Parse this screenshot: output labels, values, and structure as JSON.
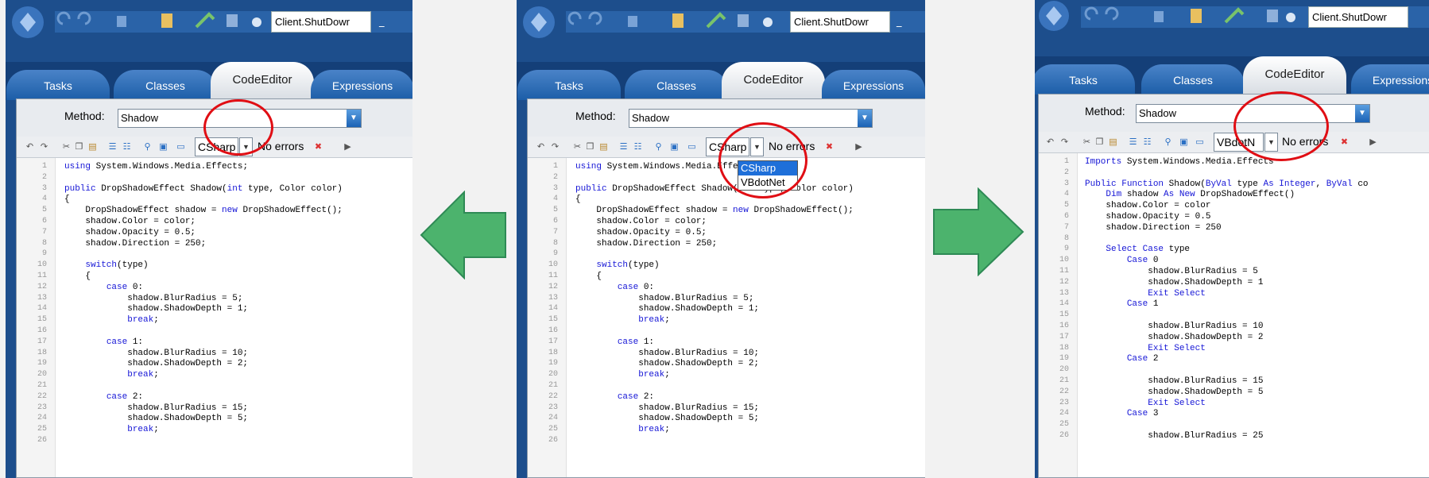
{
  "toolbar": {
    "active_item": "Client.ShutDowr",
    "right_active_item": "Client.ShutDowr",
    "minimize_glyph": "_"
  },
  "tabs": {
    "tasks": "Tasks",
    "classes": "Classes",
    "code_editor": "CodeEditor",
    "expressions": "Expressions"
  },
  "method": {
    "label": "Method:",
    "value": "Shadow"
  },
  "status": {
    "no_errors": "No errors"
  },
  "language": {
    "left": "CSharp",
    "middle": "CSharp",
    "right": "VBdotN",
    "options": [
      "CSharp",
      "VBdotNet"
    ]
  },
  "icons": [
    "app-orb-icon",
    "undo-icon",
    "redo-icon",
    "cut-icon",
    "copy-icon",
    "paste-icon",
    "indent-icon",
    "outdent-icon",
    "find-icon",
    "replace-icon",
    "comment-icon",
    "error-icon",
    "run-icon"
  ],
  "colors": {
    "highlight": "#e00e14",
    "arrow": "#4cb36d",
    "tab_bar": "#143f78",
    "keyword": "#1515d6"
  },
  "csharp_code": [
    {
      "n": "1",
      "t": "using System.Windows.Media.Effects;"
    },
    {
      "n": "2",
      "t": ""
    },
    {
      "n": "3",
      "t": "public DropShadowEffect Shadow(int type, Color color)"
    },
    {
      "n": "4",
      "t": "{"
    },
    {
      "n": "5",
      "t": "    DropShadowEffect shadow = new DropShadowEffect();"
    },
    {
      "n": "6",
      "t": "    shadow.Color = color;"
    },
    {
      "n": "7",
      "t": "    shadow.Opacity = 0.5;"
    },
    {
      "n": "8",
      "t": "    shadow.Direction = 250;"
    },
    {
      "n": "9",
      "t": ""
    },
    {
      "n": "10",
      "t": "    switch(type)"
    },
    {
      "n": "11",
      "t": "    {"
    },
    {
      "n": "12",
      "t": "        case 0:"
    },
    {
      "n": "13",
      "t": "            shadow.BlurRadius = 5;"
    },
    {
      "n": "14",
      "t": "            shadow.ShadowDepth = 1;"
    },
    {
      "n": "15",
      "t": "            break;"
    },
    {
      "n": "16",
      "t": ""
    },
    {
      "n": "17",
      "t": "        case 1:"
    },
    {
      "n": "18",
      "t": "            shadow.BlurRadius = 10;"
    },
    {
      "n": "19",
      "t": "            shadow.ShadowDepth = 2;"
    },
    {
      "n": "20",
      "t": "            break;"
    },
    {
      "n": "21",
      "t": ""
    },
    {
      "n": "22",
      "t": "        case 2:"
    },
    {
      "n": "23",
      "t": "            shadow.BlurRadius = 15;"
    },
    {
      "n": "24",
      "t": "            shadow.ShadowDepth = 5;"
    },
    {
      "n": "25",
      "t": "            break;"
    },
    {
      "n": "26",
      "t": ""
    }
  ],
  "vb_code": [
    {
      "n": "1",
      "t": "Imports System.Windows.Media.Effects"
    },
    {
      "n": "2",
      "t": ""
    },
    {
      "n": "3",
      "t": "Public Function Shadow(ByVal type As Integer, ByVal co"
    },
    {
      "n": "4",
      "t": "    Dim shadow As New DropShadowEffect()"
    },
    {
      "n": "5",
      "t": "    shadow.Color = color"
    },
    {
      "n": "6",
      "t": "    shadow.Opacity = 0.5"
    },
    {
      "n": "7",
      "t": "    shadow.Direction = 250"
    },
    {
      "n": "8",
      "t": ""
    },
    {
      "n": "9",
      "t": "    Select Case type"
    },
    {
      "n": "10",
      "t": "        Case 0"
    },
    {
      "n": "11",
      "t": "            shadow.BlurRadius = 5"
    },
    {
      "n": "12",
      "t": "            shadow.ShadowDepth = 1"
    },
    {
      "n": "13",
      "t": "            Exit Select"
    },
    {
      "n": "14",
      "t": "        Case 1"
    },
    {
      "n": "15",
      "t": ""
    },
    {
      "n": "16",
      "t": "            shadow.BlurRadius = 10"
    },
    {
      "n": "17",
      "t": "            shadow.ShadowDepth = 2"
    },
    {
      "n": "18",
      "t": "            Exit Select"
    },
    {
      "n": "19",
      "t": "        Case 2"
    },
    {
      "n": "20",
      "t": ""
    },
    {
      "n": "21",
      "t": "            shadow.BlurRadius = 15"
    },
    {
      "n": "22",
      "t": "            shadow.ShadowDepth = 5"
    },
    {
      "n": "23",
      "t": "            Exit Select"
    },
    {
      "n": "24",
      "t": "        Case 3"
    },
    {
      "n": "25",
      "t": ""
    },
    {
      "n": "26",
      "t": "            shadow.BlurRadius = 25"
    }
  ]
}
